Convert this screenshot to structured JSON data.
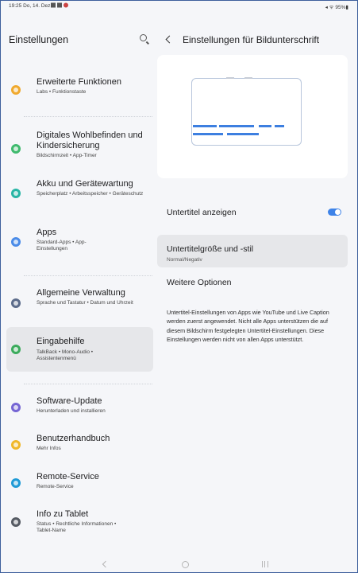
{
  "status_bar": {
    "time_date": "19:25 Do, 14. Dez.",
    "right": "◂ ᯤ 95%▮"
  },
  "left_panel": {
    "title": "Einstellungen",
    "items": [
      {
        "label": "Erweiterte Funktionen",
        "sub": "Labs • Funktionstaste",
        "icon": "star-icon",
        "color": "#f0a92e"
      },
      {
        "label": "Digitales Wohlbefinden und Kindersicherung",
        "sub": "Bildschirmzeit • App-Timer",
        "icon": "wellbeing-icon",
        "color": "#3fba6e"
      },
      {
        "label": "Akku und Gerätewartung",
        "sub": "Speicherplatz • Arbeitsspeicher • Geräteschutz",
        "icon": "device-care-icon",
        "color": "#27b5a5"
      },
      {
        "label": "Apps",
        "sub": "Standard-Apps • App-Einstellungen",
        "icon": "apps-icon",
        "color": "#4a8be8"
      },
      {
        "label": "Allgemeine Verwaltung",
        "sub": "Sprache und Tastatur • Datum und Uhrzeit",
        "icon": "general-management-icon",
        "color": "#5b6b8a"
      },
      {
        "label": "Eingabehilfe",
        "sub": "TalkBack • Mono-Audio • Assistentenmenü",
        "icon": "accessibility-icon",
        "color": "#3bab5c"
      },
      {
        "label": "Software-Update",
        "sub": "Herunterladen und installieren",
        "icon": "software-update-icon",
        "color": "#7565d4"
      },
      {
        "label": "Benutzerhandbuch",
        "sub": "Mehr Infos",
        "icon": "user-manual-icon",
        "color": "#f0b82a"
      },
      {
        "label": "Remote-Service",
        "sub": "Remote-Service",
        "icon": "remote-service-icon",
        "color": "#1f9ad6"
      },
      {
        "label": "Info zu Tablet",
        "sub": "Status • Rechtliche Informationen • Tablet-Name",
        "icon": "info-icon",
        "color": "#555a63"
      }
    ]
  },
  "right_panel": {
    "title": "Einstellungen für Bildunterschrift",
    "toggle_label": "Untertitel anzeigen",
    "toggle_on": true,
    "size_label": "Untertitelgröße und -stil",
    "size_value": "Normal/Negativ",
    "more_label": "Weitere Optionen",
    "info_text": "Untertitel-Einstellungen von Apps wie YouTube und Live Caption werden zuerst angewendet. Nicht alle Apps unterstützen die auf diesem Bildschirm festgelegten Untertitel-Einstellungen. Diese Einstellungen werden nicht von allen Apps unterstützt."
  },
  "colors": {
    "accent": "#3e83e8",
    "selected_bg": "#e6e7ea",
    "background": "#f5f6f9"
  }
}
